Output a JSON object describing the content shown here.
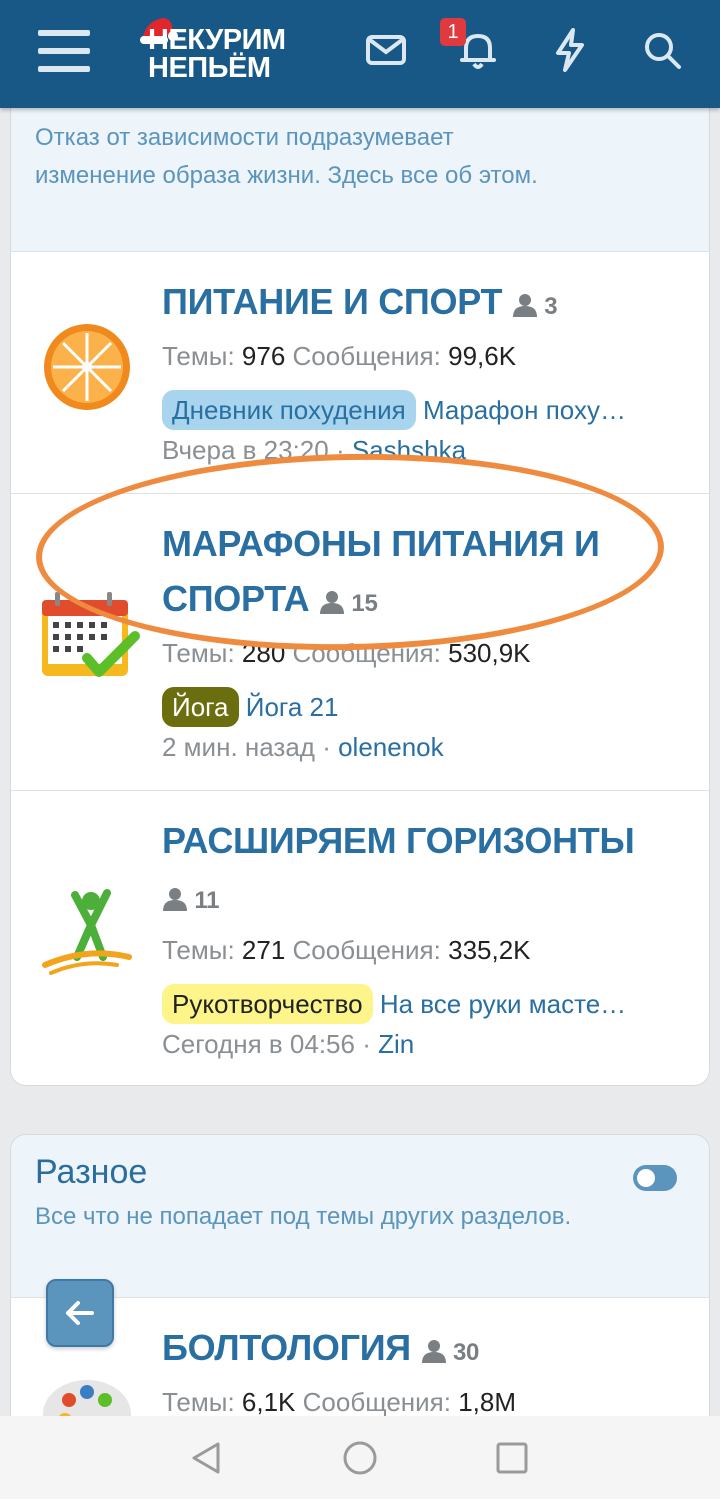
{
  "header": {
    "logo_line1": "НЕКУРИМ",
    "logo_line2": "НЕПЬЁМ",
    "notification_count": "1"
  },
  "top_category": {
    "description": "Отказ от зависимости подразумевает изменение образа жизни. Здесь все об этом."
  },
  "forums": [
    {
      "title": "ПИТАНИЕ И СПОРТ",
      "users": "3",
      "themes_label": "Темы:",
      "themes": "976",
      "messages_label": "Сообщения:",
      "messages": "99,6K",
      "prefix": "Дневник похудения",
      "thread": "Марафон поху…",
      "time": "Вчера в 23:20",
      "sep": " · ",
      "user": "Sashshka"
    },
    {
      "title": "МАРАФОНЫ ПИТАНИЯ И СПОРТА",
      "users": "15",
      "themes_label": "Темы:",
      "themes": "280",
      "messages_label": "Сообщения:",
      "messages": "530,9K",
      "prefix": "Йога",
      "thread": "Йога 21",
      "time": "2 мин. назад",
      "sep": " · ",
      "user": "olenenok"
    },
    {
      "title": "РАСШИРЯЕМ ГОРИЗОНТЫ",
      "users": "11",
      "themes_label": "Темы:",
      "themes": "271",
      "messages_label": "Сообщения:",
      "messages": "335,2K",
      "prefix": "Рукотворчество",
      "thread": "На все руки масте…",
      "time": "Сегодня в 04:56",
      "sep": " · ",
      "user": "Zin"
    }
  ],
  "category2": {
    "title": "Разное",
    "description": "Все что не попадает под темы других разделов."
  },
  "forum_bottom": {
    "title": "БОЛТОЛОГИЯ",
    "users": "30",
    "themes_label": "Темы:",
    "themes": "6,1K",
    "messages_label": "Сообщения:",
    "messages": "1,8M"
  },
  "colors": {
    "header_bg": "#185886",
    "link": "#2a6fa1",
    "highlight": "#ef8b3f",
    "prefix_diet": "#a8d4ee",
    "prefix_yoga": "#6b6e0e",
    "prefix_craft": "#fdf58a"
  }
}
